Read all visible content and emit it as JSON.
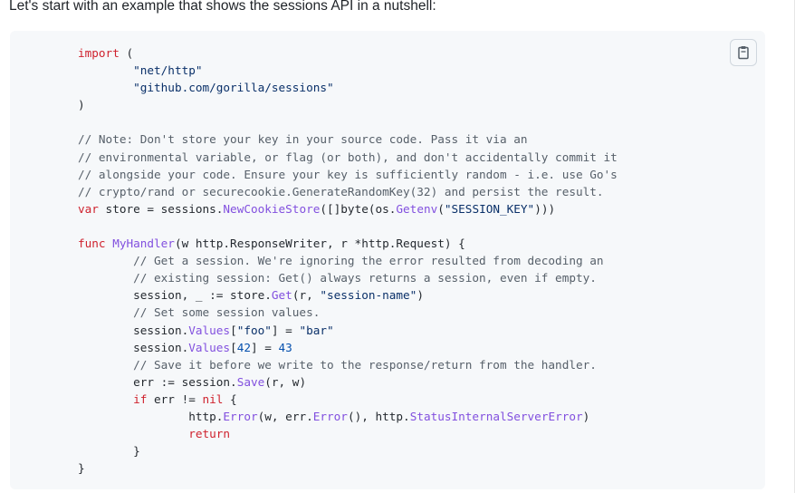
{
  "intro": {
    "text": "Let's start with an example that shows the sessions API in a nutshell:"
  },
  "copy_button": {
    "icon": "copy-icon",
    "border_color": "#d0d7de"
  },
  "colors": {
    "keyword": "#cf222e",
    "string": "#0a3069",
    "comment": "#57606a",
    "function": "#8250df",
    "number": "#0550ae",
    "plain": "#24292f",
    "code_background": "#f6f8fa"
  },
  "code": {
    "language": "go",
    "lines": [
      [
        [
          "kw",
          "import"
        ],
        [
          "p",
          " ("
        ]
      ],
      [
        [
          "p",
          "        "
        ],
        [
          "s",
          "\"net/http\""
        ]
      ],
      [
        [
          "p",
          "        "
        ],
        [
          "s",
          "\"github.com/gorilla/sessions\""
        ]
      ],
      [
        [
          "p",
          ")"
        ]
      ],
      [
        [
          "p",
          ""
        ]
      ],
      [
        [
          "c",
          "// Note: Don't store your key in your source code. Pass it via an"
        ]
      ],
      [
        [
          "c",
          "// environmental variable, or flag (or both), and don't accidentally commit it"
        ]
      ],
      [
        [
          "c",
          "// alongside your code. Ensure your key is sufficiently random - i.e. use Go's"
        ]
      ],
      [
        [
          "c",
          "// crypto/rand or securecookie.GenerateRandomKey(32) and persist the result."
        ]
      ],
      [
        [
          "kw",
          "var"
        ],
        [
          "p",
          " store = sessions."
        ],
        [
          "f",
          "NewCookieStore"
        ],
        [
          "p",
          "([]byte(os."
        ],
        [
          "f",
          "Getenv"
        ],
        [
          "p",
          "("
        ],
        [
          "s",
          "\"SESSION_KEY\""
        ],
        [
          "p",
          ")))"
        ]
      ],
      [
        [
          "p",
          ""
        ]
      ],
      [
        [
          "kw",
          "func"
        ],
        [
          "p",
          " "
        ],
        [
          "f",
          "MyHandler"
        ],
        [
          "p",
          "(w http.ResponseWriter, r *http.Request) {"
        ]
      ],
      [
        [
          "p",
          "        "
        ],
        [
          "c",
          "// Get a session. We're ignoring the error resulted from decoding an"
        ]
      ],
      [
        [
          "p",
          "        "
        ],
        [
          "c",
          "// existing session: Get() always returns a session, even if empty."
        ]
      ],
      [
        [
          "p",
          "        session, _ := store."
        ],
        [
          "f",
          "Get"
        ],
        [
          "p",
          "(r, "
        ],
        [
          "s",
          "\"session-name\""
        ],
        [
          "p",
          ")"
        ]
      ],
      [
        [
          "p",
          "        "
        ],
        [
          "c",
          "// Set some session values."
        ]
      ],
      [
        [
          "p",
          "        session."
        ],
        [
          "f",
          "Values"
        ],
        [
          "p",
          "["
        ],
        [
          "s",
          "\"foo\""
        ],
        [
          "p",
          "] = "
        ],
        [
          "s",
          "\"bar\""
        ]
      ],
      [
        [
          "p",
          "        session."
        ],
        [
          "f",
          "Values"
        ],
        [
          "p",
          "["
        ],
        [
          "n",
          "42"
        ],
        [
          "p",
          "] = "
        ],
        [
          "n",
          "43"
        ]
      ],
      [
        [
          "p",
          "        "
        ],
        [
          "c",
          "// Save it before we write to the response/return from the handler."
        ]
      ],
      [
        [
          "p",
          "        err := session."
        ],
        [
          "f",
          "Save"
        ],
        [
          "p",
          "(r, w)"
        ]
      ],
      [
        [
          "p",
          "        "
        ],
        [
          "kw",
          "if"
        ],
        [
          "p",
          " err != "
        ],
        [
          "kw",
          "nil"
        ],
        [
          "p",
          " {"
        ]
      ],
      [
        [
          "p",
          "                http."
        ],
        [
          "f",
          "Error"
        ],
        [
          "p",
          "(w, err."
        ],
        [
          "f",
          "Error"
        ],
        [
          "p",
          "(), http."
        ],
        [
          "f",
          "StatusInternalServerError"
        ],
        [
          "p",
          ")"
        ]
      ],
      [
        [
          "p",
          "                "
        ],
        [
          "kw",
          "return"
        ]
      ],
      [
        [
          "p",
          "        }"
        ]
      ],
      [
        [
          "p",
          "}"
        ]
      ]
    ]
  }
}
